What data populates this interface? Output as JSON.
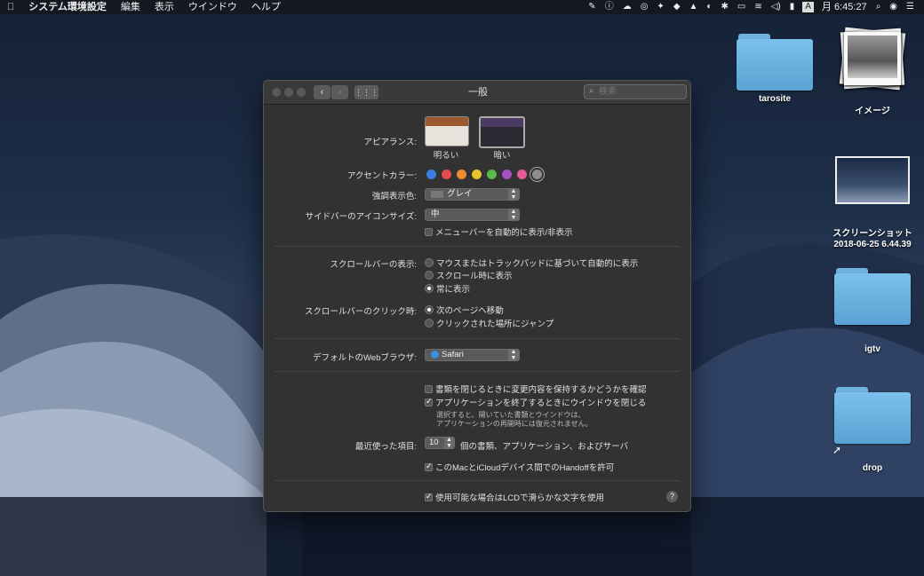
{
  "menubar": {
    "apple": "",
    "app_name": "システム環境設定",
    "menus": [
      "編集",
      "表示",
      "ウインドウ",
      "ヘルプ"
    ],
    "clock": "月 6:45:27",
    "input_source": "A"
  },
  "desktop": {
    "items": [
      {
        "label": "tarosite"
      },
      {
        "label": "イメージ"
      },
      {
        "label_line1": "スクリーンショット",
        "label_line2": "2018-06-25 6.44.39"
      },
      {
        "label": "igtv"
      },
      {
        "label": "drop"
      }
    ]
  },
  "window": {
    "title": "一般",
    "search_placeholder": "検索",
    "appearance": {
      "label": "アピアランス:",
      "options": [
        "明るい",
        "暗い"
      ],
      "selected": "暗い"
    },
    "accent": {
      "label": "アクセントカラー:",
      "colors": [
        "#3b7de0",
        "#e54b4b",
        "#ee8a32",
        "#e9c230",
        "#58b848",
        "#a74fc0",
        "#e45a9a",
        "#8e8e8e"
      ],
      "selected_index": 7
    },
    "highlight": {
      "label": "強調表示色:",
      "value": "グレイ"
    },
    "sidebar_icon": {
      "label": "サイドバーのアイコンサイズ:",
      "value": "中"
    },
    "menubar_autohide": {
      "label": "メニューバーを自動的に表示/非表示",
      "checked": false
    },
    "scrollbar_show": {
      "label": "スクロールバーの表示:",
      "options": [
        "マウスまたはトラックパッドに基づいて自動的に表示",
        "スクロール時に表示",
        "常に表示"
      ],
      "selected_index": 2
    },
    "scrollbar_click": {
      "label": "スクロールバーのクリック時:",
      "options": [
        "次のページへ移動",
        "クリックされた場所にジャンプ"
      ],
      "selected_index": 0
    },
    "browser": {
      "label": "デフォルトのWebブラウザ:",
      "value": "Safari"
    },
    "ask_keep_changes": {
      "label": "書類を閉じるときに変更内容を保持するかどうかを確認",
      "checked": false
    },
    "close_windows": {
      "label": "アプリケーションを終了するときにウインドウを閉じる",
      "checked": true
    },
    "close_windows_note": [
      "選択すると、開いていた書類とウインドウは、",
      "アプリケーションの再開時には復元されません。"
    ],
    "recent": {
      "label": "最近使った項目:",
      "value": "10",
      "suffix": "個の書類、アプリケーション、およびサーバ"
    },
    "handoff": {
      "label": "このMacとiCloudデバイス間でのHandoffを許可",
      "checked": true
    },
    "lcd_smoothing": {
      "label": "使用可能な場合はLCDで滑らかな文字を使用",
      "checked": true
    },
    "help": "?"
  }
}
